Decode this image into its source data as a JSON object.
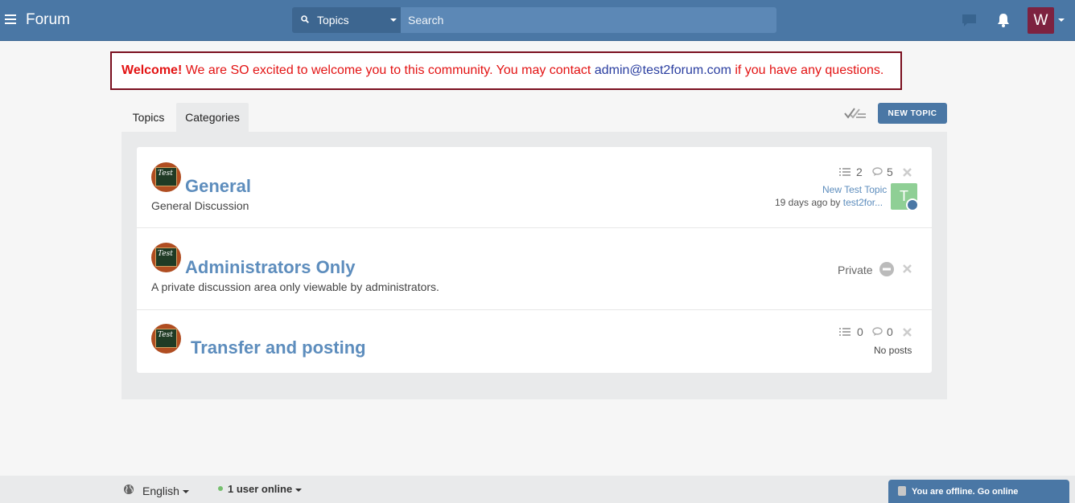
{
  "header": {
    "brand": "Forum",
    "search_scope": "Topics",
    "search_placeholder": "Search",
    "avatar_letter": "W",
    "avatar_color": "#7d2240"
  },
  "welcome": {
    "bold": "Welcome!",
    "text_before": " We are SO excited to welcome you to this community. You may contact ",
    "email": "admin@test2forum.com",
    "text_after": " if you have any questions."
  },
  "tabs": [
    {
      "label": "Topics",
      "active": false
    },
    {
      "label": "Categories",
      "active": true
    }
  ],
  "toolbar": {
    "new_topic_label": "NEW TOPIC"
  },
  "categories": [
    {
      "thumb_text": "Test",
      "title": "General",
      "description": "General Discussion",
      "topics": "2",
      "posts": "5",
      "last_post_title": "New Test Topic",
      "last_post_meta": "19 days ago by ",
      "last_post_user": "test2for...",
      "last_post_avatar": "T"
    },
    {
      "thumb_text": "Test",
      "title": "Administrators Only",
      "description": "A private discussion area only viewable by administrators.",
      "private_label": "Private"
    },
    {
      "thumb_text": "Test",
      "title": "Transfer and posting",
      "topics": "0",
      "posts": "0",
      "no_posts": "No posts"
    }
  ],
  "footer": {
    "language": "English",
    "online": "1 user online",
    "offline_message": "You are offline. Go online"
  },
  "colors": {
    "primary": "#4a77a5",
    "link": "#5d8dbd",
    "welcome_red": "#e31313",
    "welcome_border": "#7a0f1f",
    "online_green": "#76c06e"
  }
}
